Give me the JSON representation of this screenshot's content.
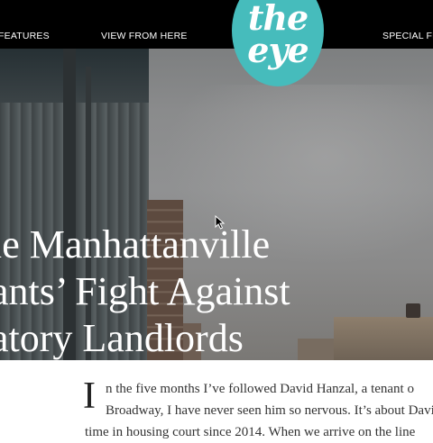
{
  "nav": {
    "features_label": "FEATURES",
    "view_label": "VIEW FROM HERE",
    "special_label": "SPECIAL FEAT"
  },
  "logo": {
    "line1": "the",
    "line2": "eye",
    "color": "#46bcbc"
  },
  "hero": {
    "headline_lines": [
      "le Manhattanville",
      "ants’ Fight Against",
      "atory Landlords"
    ]
  },
  "article": {
    "dropcap": "I",
    "line1": "n the five months I’ve followed David Hanzal, a tenant o",
    "line2": "Broadway, I have never seen him so nervous. It’s about David",
    "line3": "time in housing court since 2014. When we arrive on the line"
  }
}
